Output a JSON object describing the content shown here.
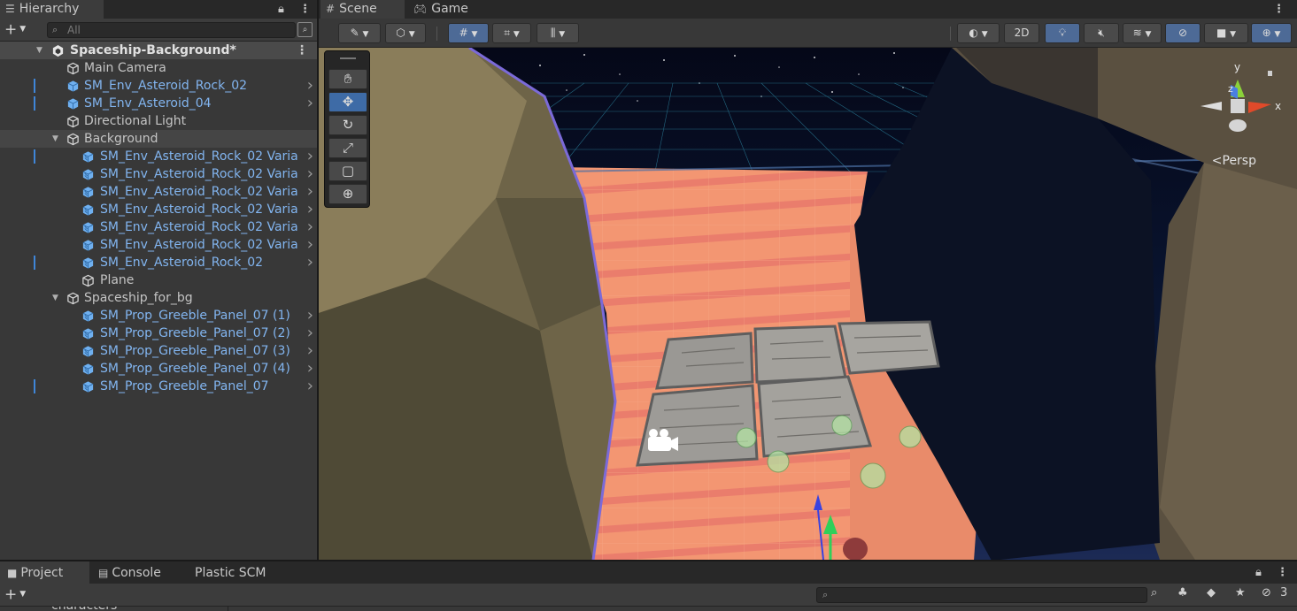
{
  "hierarchy": {
    "tab_label": "Hierarchy",
    "search_placeholder": "All",
    "rows": [
      {
        "label": "Spaceship-Background*",
        "kind": "scene",
        "color": "default"
      },
      {
        "label": "Main Camera",
        "kind": "object",
        "color": "default"
      },
      {
        "label": "SM_Env_Asteroid_Rock_02",
        "kind": "prefab",
        "color": "blue"
      },
      {
        "label": "SM_Env_Asteroid_04",
        "kind": "prefab",
        "color": "blue"
      },
      {
        "label": "Directional Light",
        "kind": "object",
        "color": "default"
      },
      {
        "label": "Background",
        "kind": "object",
        "color": "default"
      },
      {
        "label": "SM_Env_Asteroid_Rock_02 Varia",
        "kind": "prefab-variant",
        "color": "blue"
      },
      {
        "label": "SM_Env_Asteroid_Rock_02 Varia",
        "kind": "prefab-variant",
        "color": "blue"
      },
      {
        "label": "SM_Env_Asteroid_Rock_02 Varia",
        "kind": "prefab-variant",
        "color": "blue"
      },
      {
        "label": "SM_Env_Asteroid_Rock_02 Varia",
        "kind": "prefab-variant",
        "color": "blue"
      },
      {
        "label": "SM_Env_Asteroid_Rock_02 Varia",
        "kind": "prefab-variant",
        "color": "blue"
      },
      {
        "label": "SM_Env_Asteroid_Rock_02 Varia",
        "kind": "prefab-variant",
        "color": "blue"
      },
      {
        "label": "SM_Env_Asteroid_Rock_02",
        "kind": "prefab-variant",
        "color": "blue"
      },
      {
        "label": "Plane",
        "kind": "object",
        "color": "default"
      },
      {
        "label": "Spaceship_for_bg",
        "kind": "object",
        "color": "default"
      },
      {
        "label": "SM_Prop_Greeble_Panel_07 (1)",
        "kind": "prefab-variant",
        "color": "blue"
      },
      {
        "label": "SM_Prop_Greeble_Panel_07 (2)",
        "kind": "prefab-variant",
        "color": "blue"
      },
      {
        "label": "SM_Prop_Greeble_Panel_07 (3)",
        "kind": "prefab-variant",
        "color": "blue"
      },
      {
        "label": "SM_Prop_Greeble_Panel_07 (4)",
        "kind": "prefab-variant",
        "color": "blue"
      },
      {
        "label": "SM_Prop_Greeble_Panel_07",
        "kind": "prefab-variant",
        "color": "blue"
      }
    ]
  },
  "scene": {
    "tabs": {
      "scene": "Scene",
      "game": "Game"
    },
    "toolbar": {
      "two_d": "2D"
    },
    "gizmo": {
      "y": "y",
      "x": "x",
      "z": "z",
      "projection": "<Persp"
    },
    "tools": [
      "hand-tool",
      "move-tool",
      "rotate-tool",
      "scale-tool",
      "rect-tool",
      "transform-tool"
    ]
  },
  "bottom": {
    "tabs": {
      "project": "Project",
      "console": "Console",
      "plastic": "Plastic SCM"
    },
    "hidden_count": "3",
    "peek_item": "characters"
  },
  "colors": {
    "prefab_blue": "#82b5f0",
    "selected_tool": "#3e6ba6",
    "floor": "#f0906a"
  }
}
